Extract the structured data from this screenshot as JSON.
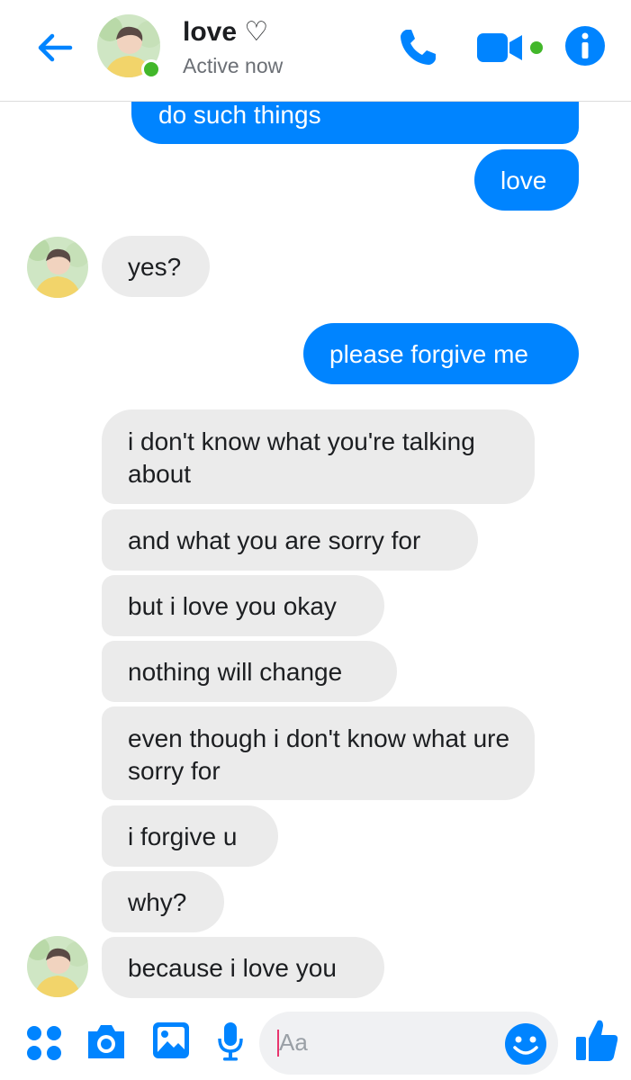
{
  "header": {
    "name": "love ♡",
    "status": "Active now",
    "icons": [
      "back-arrow-icon",
      "phone-icon",
      "video-camera-icon",
      "info-icon"
    ],
    "accent": "#0084ff",
    "online_color": "#42b72a"
  },
  "messages": [
    {
      "from": "me",
      "text": "do such things"
    },
    {
      "from": "me",
      "text": "love"
    },
    {
      "from": "them",
      "text": "yes?"
    },
    {
      "from": "me",
      "text": "please forgive me"
    },
    {
      "from": "them",
      "text": "i don't know what you're talking about"
    },
    {
      "from": "them",
      "text": "and what you are sorry for"
    },
    {
      "from": "them",
      "text": "but i love you okay"
    },
    {
      "from": "them",
      "text": "nothing will change"
    },
    {
      "from": "them",
      "text": "even though i don't know what ure sorry for"
    },
    {
      "from": "them",
      "text": "i forgive u"
    },
    {
      "from": "them",
      "text": "why?"
    },
    {
      "from": "them",
      "text": "because i love you"
    }
  ],
  "composer": {
    "placeholder": "Aa",
    "icons": [
      "apps-grid-icon",
      "camera-icon",
      "image-icon",
      "microphone-icon",
      "emoji-icon",
      "thumbs-up-icon"
    ]
  }
}
